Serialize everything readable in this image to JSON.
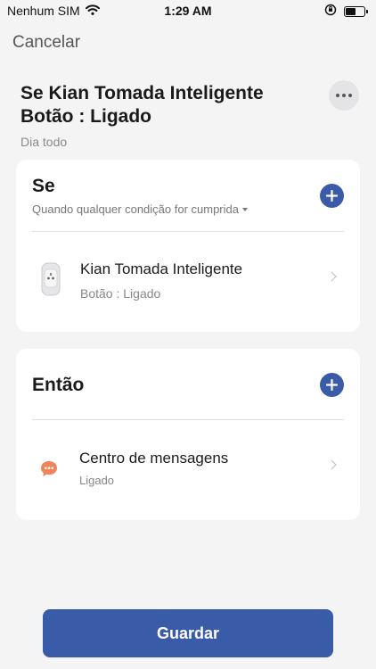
{
  "status_bar": {
    "carrier": "Nenhum SIM",
    "time": "1:29 AM"
  },
  "nav": {
    "cancel_label": "Cancelar"
  },
  "scene": {
    "title": "Se Kian Tomada Inteligente Botão : Ligado",
    "schedule": "Dia todo"
  },
  "if_section": {
    "heading": "Se",
    "condition_mode": "Quando qualquer condição for cumprida",
    "items": [
      {
        "title": "Kian Tomada Inteligente",
        "subtitle": "Botão : Ligado"
      }
    ]
  },
  "then_section": {
    "heading": "Então",
    "items": [
      {
        "title": "Centro de mensagens",
        "subtitle": "Ligado"
      }
    ]
  },
  "footer": {
    "save_label": "Guardar"
  },
  "colors": {
    "accent": "#3a5ba8",
    "message_icon": "#f0845a"
  }
}
